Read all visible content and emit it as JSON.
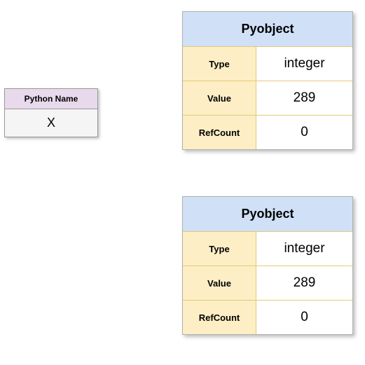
{
  "python_name": {
    "header": "Python Name",
    "value": "X"
  },
  "pyobject1": {
    "title": "Pyobject",
    "type_label": "Type",
    "type_value": "integer",
    "value_label": "Value",
    "value_value": "289",
    "refcount_label": "RefCount",
    "refcount_value": "0"
  },
  "pyobject2": {
    "title": "Pyobject",
    "type_label": "Type",
    "type_value": "integer",
    "value_label": "Value",
    "value_value": "289",
    "refcount_label": "RefCount",
    "refcount_value": "0"
  }
}
